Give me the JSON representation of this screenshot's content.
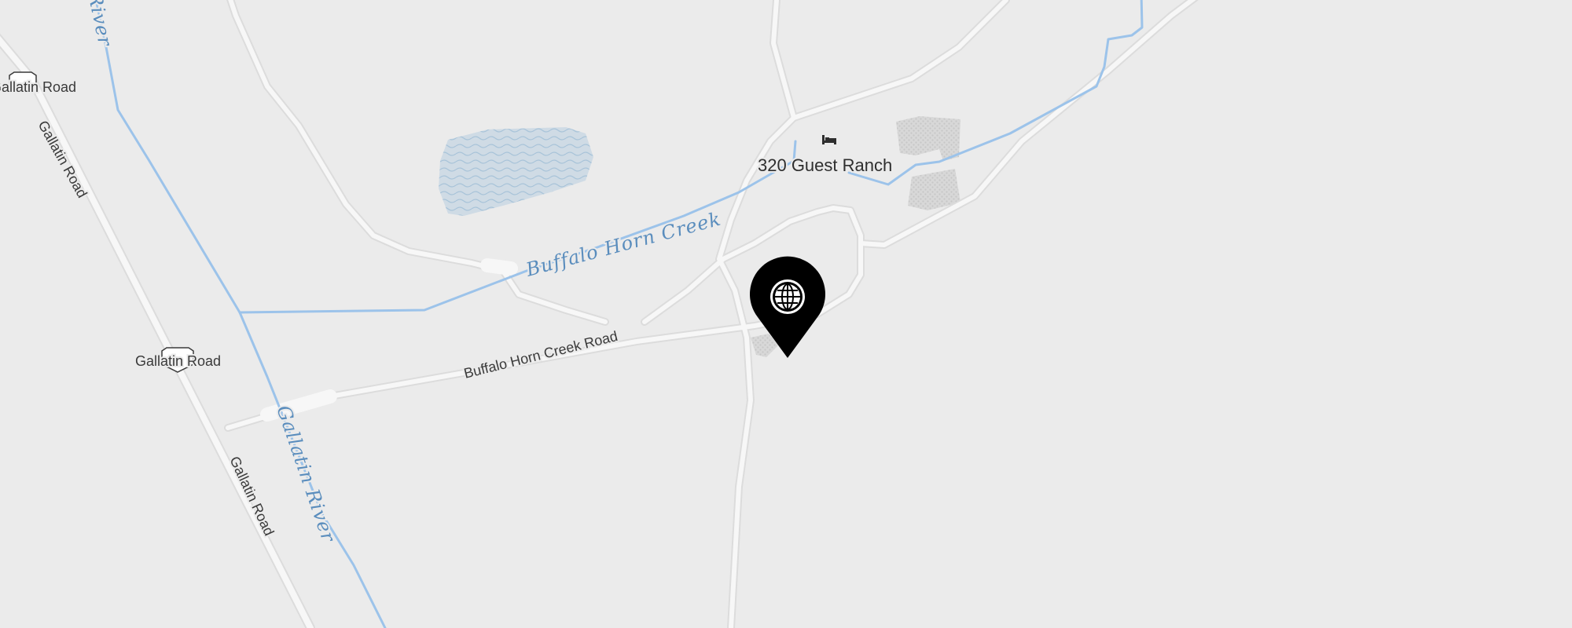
{
  "map": {
    "roads": {
      "gallatin_road_label": "Gallatin Road",
      "gallatin_road_shield_label": "Gallatin Road",
      "gallatin_road_shield_label_top": "Gallatin Road",
      "buffalo_horn_creek_road_label": "Buffalo Horn Creek Road"
    },
    "waterways": {
      "buffalo_horn_creek_label": "Buffalo Horn Creek",
      "gallatin_river_label": "Gallatin River",
      "river_label_top": "River"
    },
    "poi": {
      "name": "320 Guest Ranch",
      "icon": "bed-icon"
    },
    "marker": {
      "icon": "globe-icon"
    },
    "colors": {
      "background": "#ebebeb",
      "water": "#9cc3ea",
      "road": "#f7f7f7",
      "water_label": "#5a8dbd",
      "marker": "#000000"
    }
  }
}
